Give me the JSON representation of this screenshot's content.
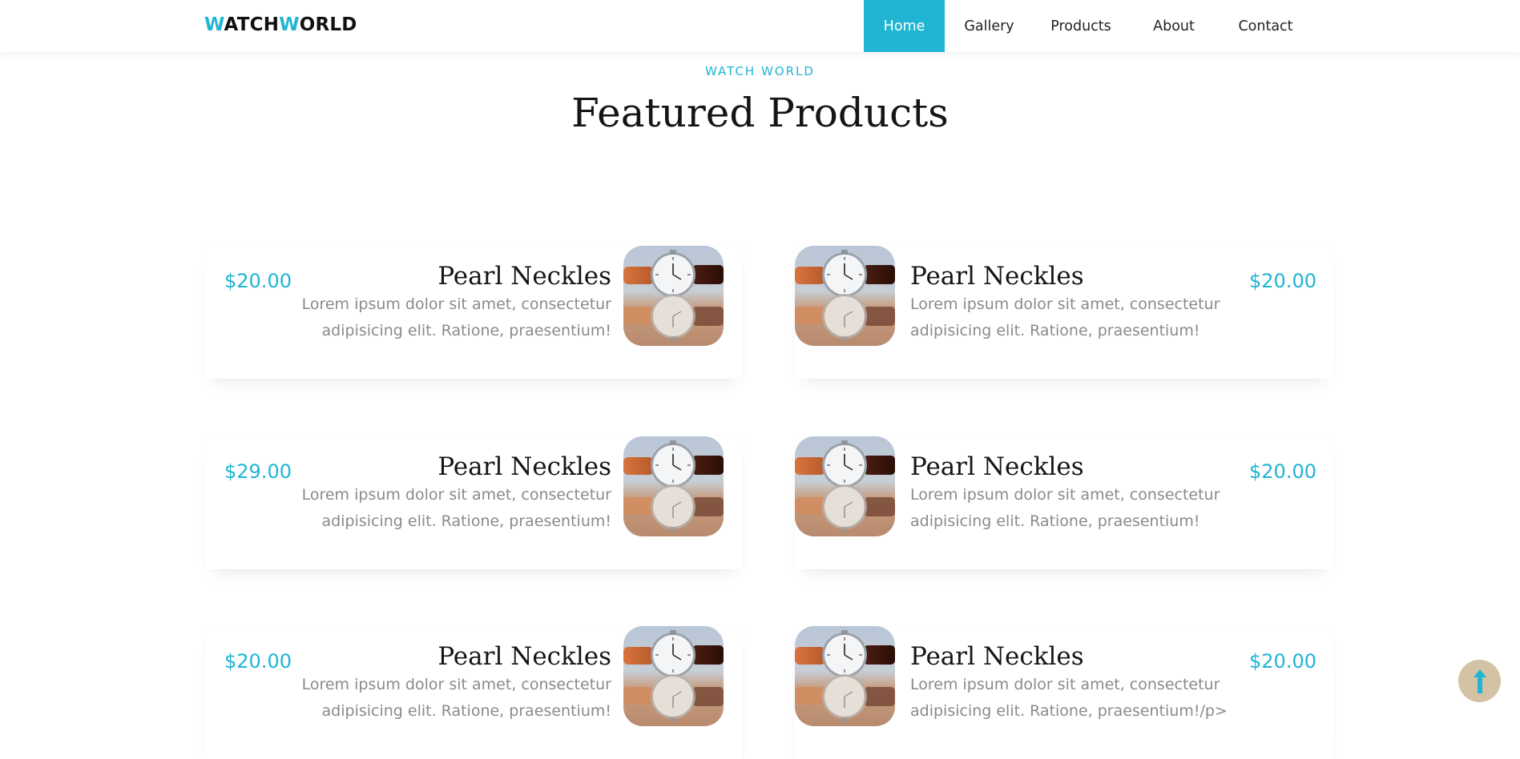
{
  "brand": {
    "part1": "W",
    "part2": "ATCH",
    "part3": "W",
    "part4": "ORLD"
  },
  "nav": [
    {
      "label": "Home",
      "active": true
    },
    {
      "label": "Gallery",
      "active": false
    },
    {
      "label": "Products",
      "active": false
    },
    {
      "label": "About",
      "active": false
    },
    {
      "label": "Contact",
      "active": false
    }
  ],
  "section": {
    "eyebrow": "WATCH WORLD",
    "title": "Featured Products"
  },
  "products": [
    {
      "price": "$20.00",
      "name": "Pearl Neckles",
      "desc": "Lorem ipsum dolor sit amet, consectetur adipisicing elit. Ratione, praesentium!"
    },
    {
      "price": "$20.00",
      "name": "Pearl Neckles",
      "desc": "Lorem ipsum dolor sit amet, consectetur adipisicing elit. Ratione, praesentium!"
    },
    {
      "price": "$29.00",
      "name": "Pearl Neckles",
      "desc": "Lorem ipsum dolor sit amet, consectetur adipisicing elit. Ratione, praesentium!"
    },
    {
      "price": "$20.00",
      "name": "Pearl Neckles",
      "desc": "Lorem ipsum dolor sit amet, consectetur adipisicing elit. Ratione, praesentium!"
    },
    {
      "price": "$20.00",
      "name": "Pearl Neckles",
      "desc": "Lorem ipsum dolor sit amet, consectetur adipisicing elit. Ratione, praesentium!"
    },
    {
      "price": "$20.00",
      "name": "Pearl Neckles",
      "desc": "Lorem ipsum dolor sit amet, consectetur adipisicing elit. Ratione, praesentium!/p>"
    }
  ],
  "back_to_top": {
    "icon": "arrow-up-icon"
  },
  "colors": {
    "accent": "#1fb5d3",
    "back_to_top_bg": "#d3c3a4"
  }
}
